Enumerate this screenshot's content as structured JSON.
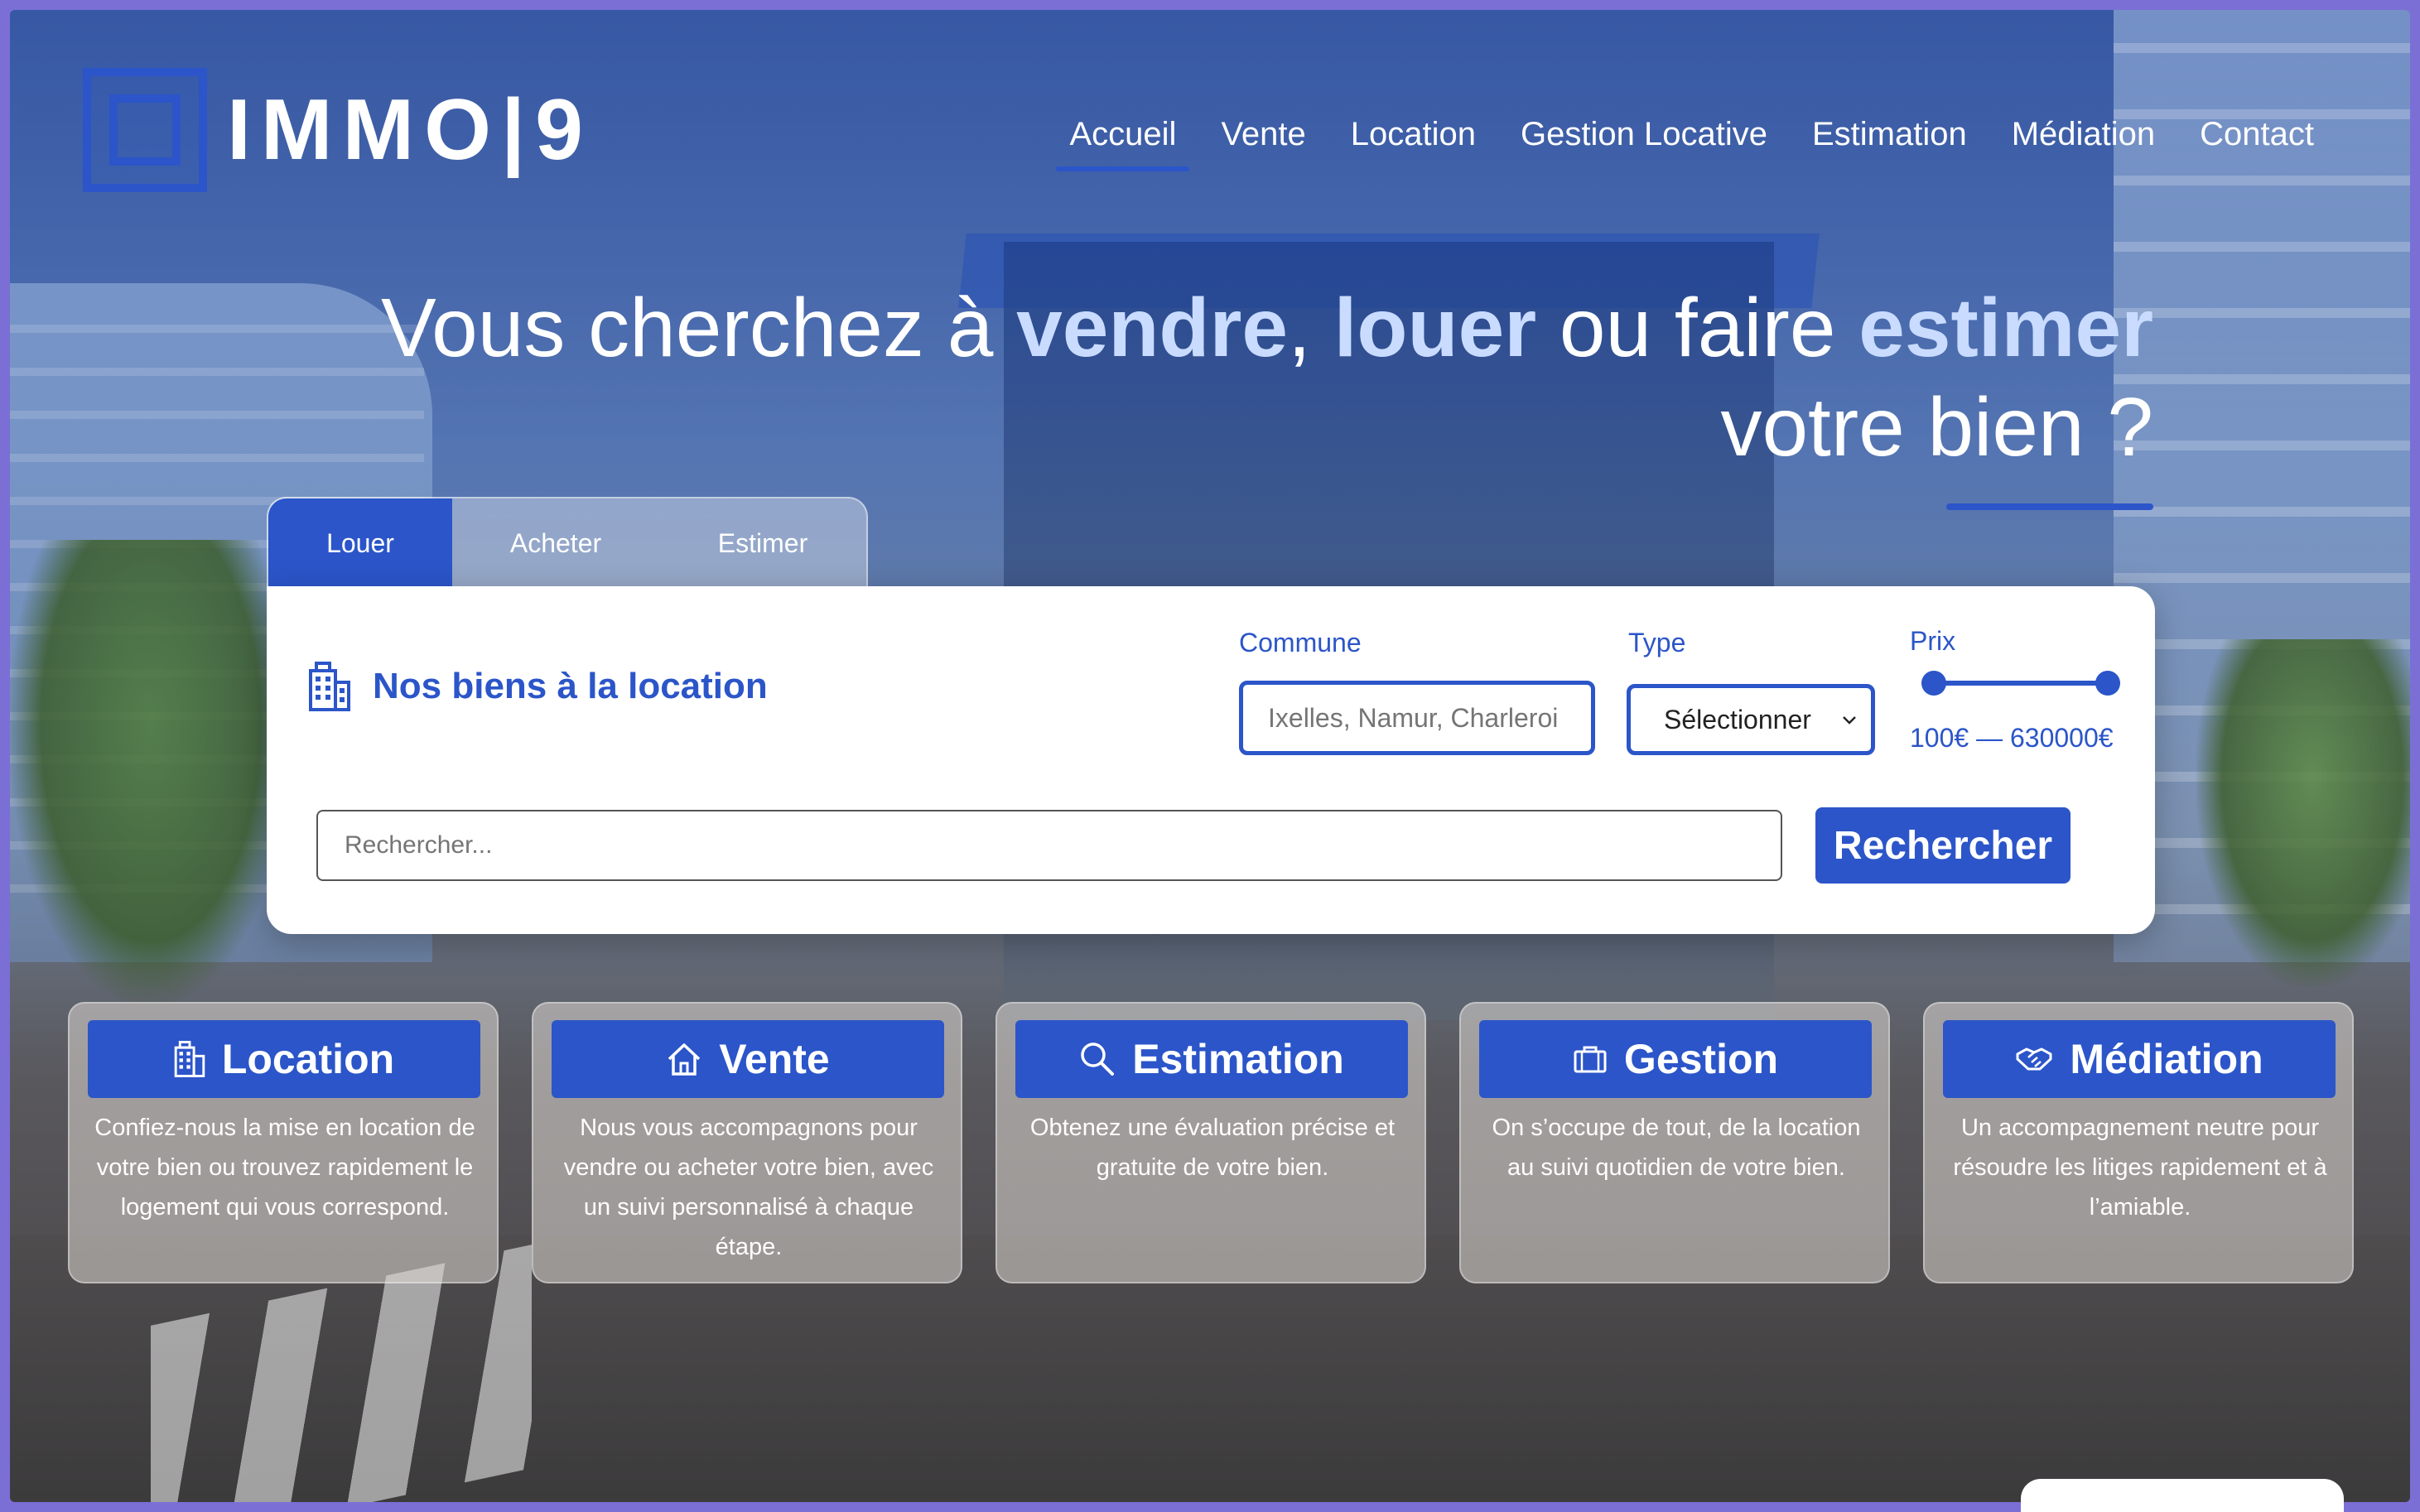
{
  "brand": {
    "logo_text": "IMMO|9",
    "accent_color": "#2b55c9"
  },
  "nav": {
    "items": [
      {
        "label": "Accueil",
        "active": true
      },
      {
        "label": "Vente",
        "active": false
      },
      {
        "label": "Location",
        "active": false
      },
      {
        "label": "Gestion Locative",
        "active": false
      },
      {
        "label": "Estimation",
        "active": false
      },
      {
        "label": "Médiation",
        "active": false
      },
      {
        "label": "Contact",
        "active": false
      }
    ]
  },
  "hero": {
    "part1": "Vous cherchez à ",
    "highlight1": "vendre",
    "part2": ", ",
    "highlight2": "louer",
    "part3": " ou faire ",
    "highlight3": "estimer",
    "part4": " votre bien ?"
  },
  "search": {
    "tabs": [
      {
        "label": "Louer",
        "active": true
      },
      {
        "label": "Acheter",
        "active": false
      },
      {
        "label": "Estimer",
        "active": false
      }
    ],
    "heading": "Nos biens à la location",
    "heading_icon": "building-icon",
    "commune_label": "Commune",
    "commune_placeholder": "Ixelles, Namur, Charleroi",
    "type_label": "Type",
    "type_value": "Sélectionner",
    "price_label": "Prix",
    "price_min": 100,
    "price_max": 630000,
    "price_range_text": "100€ — 630000€",
    "query_placeholder": "Rechercher...",
    "submit_label": "Rechercher"
  },
  "services": [
    {
      "title": "Location",
      "icon": "building-icon",
      "description": "Confiez-nous la mise en location de votre bien ou trouvez rapidement le logement qui vous correspond."
    },
    {
      "title": "Vente",
      "icon": "house-icon",
      "description": "Nous vous accompagnons pour vendre ou acheter votre bien, avec un suivi personnalisé à chaque étape."
    },
    {
      "title": "Estimation",
      "icon": "magnifier-icon",
      "description": "Obtenez une évaluation précise et gratuite de votre bien."
    },
    {
      "title": "Gestion",
      "icon": "briefcase-icon",
      "description": "On s’occupe de tout, de la location au suivi quotidien de votre bien."
    },
    {
      "title": "Médiation",
      "icon": "handshake-icon",
      "description": "Un accompagnement neutre pour résoudre les litiges rapidement et à l’amiable."
    }
  ]
}
